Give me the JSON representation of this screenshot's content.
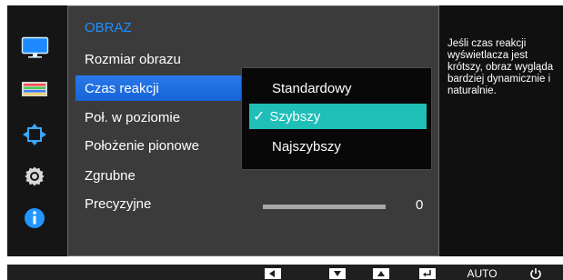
{
  "menu": {
    "title": "OBRAZ",
    "items": [
      {
        "label": "Rozmiar obrazu"
      },
      {
        "label": "Czas reakcji"
      },
      {
        "label": "Poł. w poziomie"
      },
      {
        "label": "Położenie pionowe"
      },
      {
        "label": "Zgrubne"
      },
      {
        "label": "Precyzyjne"
      }
    ]
  },
  "submenu": {
    "options": [
      {
        "label": "Standardowy"
      },
      {
        "label": "Szybszy"
      },
      {
        "label": "Najszybszy"
      }
    ],
    "selected_index": 1
  },
  "slider": {
    "value": "0"
  },
  "help": {
    "lines": [
      "Jeśli czas reakcji",
      "wyświetlacza jest",
      "krótszy, obraz wygląda",
      "bardziej dynamicznie i",
      "naturalnie."
    ]
  },
  "bottom_bar": {
    "auto_label": "AUTO",
    "buttons": [
      "left-arrow",
      "down-arrow",
      "up-arrow",
      "enter",
      "AUTO",
      "power"
    ]
  },
  "colors": {
    "title": "#1f8fff",
    "selected_menu": "#1565d8",
    "selected_option": "#1fbfb8",
    "background": "#101010",
    "panel": "#3b3b3b"
  }
}
